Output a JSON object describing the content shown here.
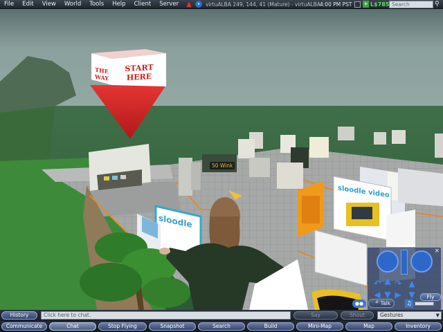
{
  "menu": {
    "items": [
      "File",
      "Edit",
      "View",
      "World",
      "Tools",
      "Help",
      "Client",
      "Server"
    ],
    "location": "virtuALBA 249, 144, 41 (Mature) - virtuALBA",
    "clock": "4:00 PM PST",
    "balance": "L$785",
    "search_placeholder": "Search"
  },
  "world": {
    "sign_start": "START HERE",
    "sign_side": "THE WAY",
    "sloodle_video": "sloodle video",
    "sloodle_logo": "sloodle",
    "float_label": "50 Wink"
  },
  "movement": {
    "fly_label": "Fly",
    "close": "×"
  },
  "voice": {
    "talk_label": "Talk"
  },
  "chat": {
    "history_label": "History",
    "input_placeholder": "Click here to chat.",
    "say_label": "Say",
    "shout_label": "Shout",
    "gestures_label": "Gestures"
  },
  "toolbar": {
    "buttons": [
      "Communicate",
      "Chat",
      "Stop Flying",
      "Snapshot",
      "Search",
      "Build",
      "Mini-Map",
      "Map",
      "Inventory"
    ]
  },
  "colors": {
    "accent": "#3e76c9",
    "balance": "#5fe05f",
    "sign_red": "#d8262a"
  }
}
